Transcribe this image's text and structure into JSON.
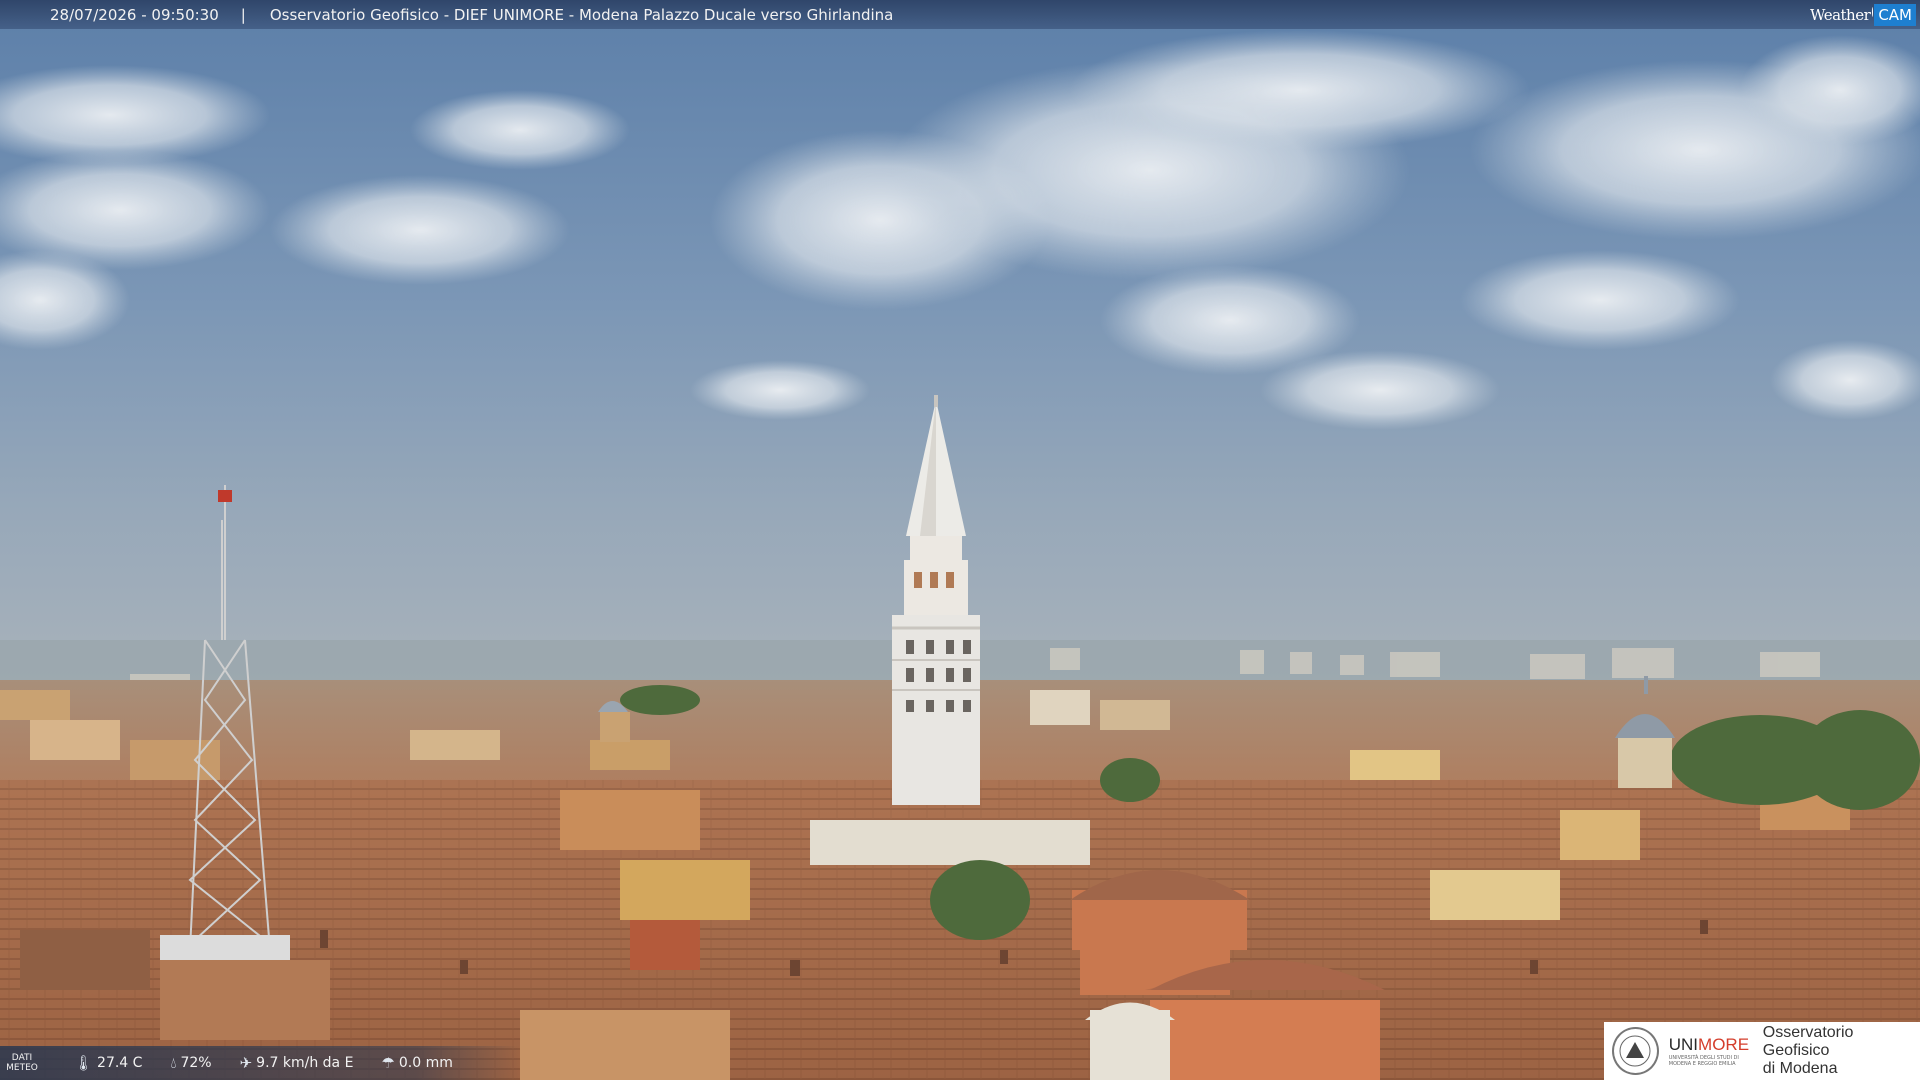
{
  "header": {
    "timestamp": "28/07/2026 - 09:50:30",
    "separator": "|",
    "caption": "Osservatorio Geofisico - DIEF UNIMORE - Modena Palazzo Ducale verso Ghirlandina"
  },
  "brand": {
    "weather": "Weather",
    "cam": "CAM",
    "accent": "#1e7fd0"
  },
  "meteo": {
    "label_line1": "DATI",
    "label_line2": "METEO",
    "temperature": "27.4 C",
    "humidity": "72%",
    "wind": "9.7 km/h da E",
    "rain": "0.0 mm",
    "icons": [
      "thermometer-icon",
      "humidity-drop-icon",
      "wind-icon",
      "rain-gauge-icon"
    ]
  },
  "logo": {
    "uni": "UNI",
    "more": "MORE",
    "sub": "UNIVERSITÀ DEGLI STUDI DI MODENA E REGGIO EMILIA",
    "obs_line1": "Osservatorio Geofisico",
    "obs_line2": "di Modena",
    "accent": "#d43d2b"
  }
}
